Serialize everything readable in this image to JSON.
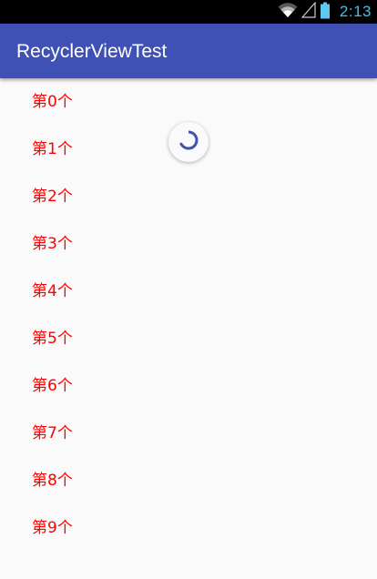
{
  "status_bar": {
    "time": "2:13",
    "icons": [
      "wifi-icon",
      "cell-signal-icon",
      "battery-icon"
    ],
    "time_color": "#3ec1f3"
  },
  "app_bar": {
    "title": "RecyclerViewTest",
    "color": "#3f51b5"
  },
  "list": {
    "item_color": "#ff0000",
    "items": [
      {
        "label": "第0个"
      },
      {
        "label": "第1个"
      },
      {
        "label": "第2个"
      },
      {
        "label": "第3个"
      },
      {
        "label": "第4个"
      },
      {
        "label": "第5个"
      },
      {
        "label": "第6个"
      },
      {
        "label": "第7个"
      },
      {
        "label": "第8个"
      },
      {
        "label": "第9个"
      }
    ]
  },
  "refresh_indicator": {
    "icon": "loading-spinner-icon",
    "color": "#3f51b5"
  }
}
